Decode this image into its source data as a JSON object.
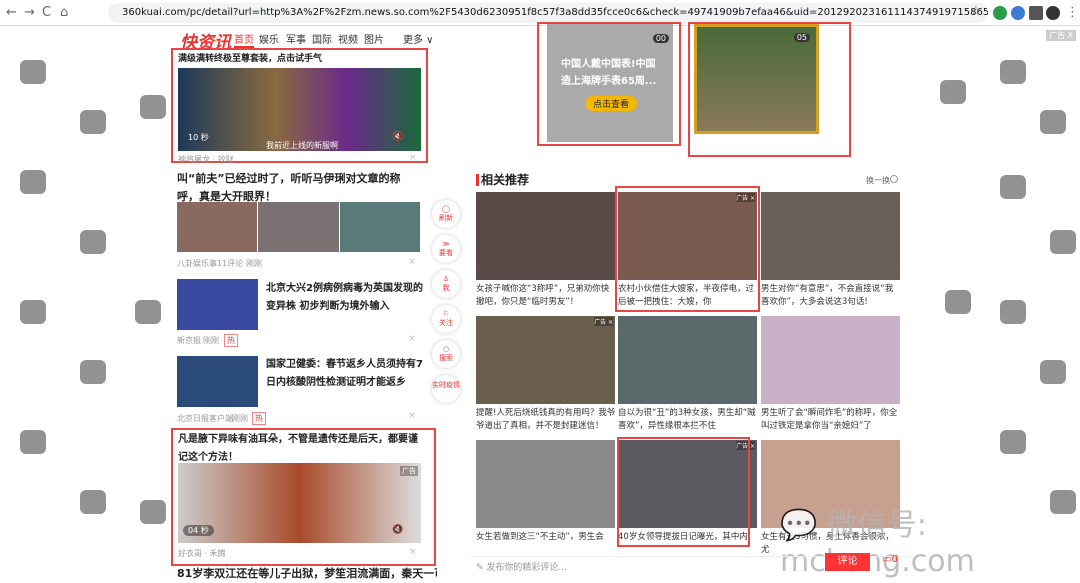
{
  "browser": {
    "url": "360kuai.com/pc/detail?url=http%3A%2F%2Fzm.news.so.com%2F5430d6230951f8c57f3a8dd35fcce0c6&check=49741909b7efaa46&uid=201292023161114374919715865257&sign=360_c4ab1d29&djsource=DH3Cra&tj_url=9...",
    "back": "←",
    "forward": "→",
    "reload": "C",
    "home": "⌂",
    "star": "☆",
    "menu": "⋮"
  },
  "site": {
    "logo": "快资讯",
    "nav": [
      "首页",
      "娱乐",
      "军事",
      "国际",
      "视频",
      "图片",
      "更多 ∨"
    ]
  },
  "left": {
    "ad1": {
      "title": "满级满转终极至尊套装，点击试手气",
      "duration": "10 秒",
      "subtitle": "我前近上线的新服啊",
      "source": "神将屠龙 · 效财"
    },
    "article1": {
      "title": "叫“前夫”已经过时了，听听马伊琍对文章的称呼，真是大开眼界！",
      "source": "八卦娱乐事",
      "comments": "11评论",
      "time": "刚刚"
    },
    "article2": {
      "title": "北京大兴2例病例病毒为英国发现的变异株 初步判断为境外输入",
      "source": "新京报",
      "time": "刚刚",
      "badge": "热"
    },
    "article3": {
      "title": "国家卫健委：春节返乡人员须持有7日内核酸阴性检测证明才能返乡",
      "source": "北京日报客户端",
      "time": "刚刚",
      "badge": "热"
    },
    "ad2": {
      "title": "凡是腋下异味有油耳朵，不管是遗传还是后天，都要谨记这个方法！",
      "duration": "04 秒",
      "ad": "广告",
      "source": "好衣哥 · 禾腾"
    },
    "next_title": "81岁李双江还在等儿子出狱，梦笙泪流满面，秦天一可能没机"
  },
  "side_buttons": [
    "刷新",
    "要看",
    "我",
    "关注",
    "搜索",
    "实时疫情"
  ],
  "top_ads": {
    "ad1": {
      "counter": "00",
      "text": "中国人戴中国表!中国造上海牌手表65周...",
      "button": "点击查看"
    },
    "ad2": {
      "counter": "05"
    }
  },
  "related": {
    "title": "相关推荐",
    "refresh": "换一换",
    "items": [
      {
        "caption": "女孩子喊你这“3称呼”，兄弟劝你快撤吧，你只是“临时男友”！",
        "color": "#5a4a48"
      },
      {
        "caption": "农村小伙借住大嫂家，半夜停电，过后被一把拽住：大嫂，你",
        "ad": "广告 ×",
        "color": "#7a5a50"
      },
      {
        "caption": "男生对你“有意思”，不会直接说“我喜欢你”，大多会说这3句话!",
        "color": "#6a6058"
      },
      {
        "caption": "提醒!人死后烧纸钱真的有用吗？我爷爷道出了真相，并不是封建迷信！",
        "ad": "广告 ×",
        "color": "#6a5e4c"
      },
      {
        "caption": "自以为很“丑”的3种女孩，男生却“贼喜欢”，异性缘根本拦不住",
        "color": "#5a6a6a"
      },
      {
        "caption": "男生听了会“瞬间炸毛”的称呼，你全叫过铁定是拿你当“亲媳妇”了",
        "color": "#c8b0c8"
      },
      {
        "caption": "女生若做到这三“不主动”，男生会",
        "color": "#8a8a8a"
      },
      {
        "caption": "40岁女领导提拔日记曝光，其中内",
        "ad": "广告 ×",
        "color": "#5a5a60"
      },
      {
        "caption": "女生有这3习惯，身上体香会很浓，尤",
        "color": "#c8a090"
      }
    ]
  },
  "comment": {
    "placeholder": "发布你的精彩评论...",
    "button": "评论",
    "count": "0"
  },
  "watermark": "微信号: mcbang.com",
  "corner_ad": "广告 X",
  "accent": "#e33333"
}
